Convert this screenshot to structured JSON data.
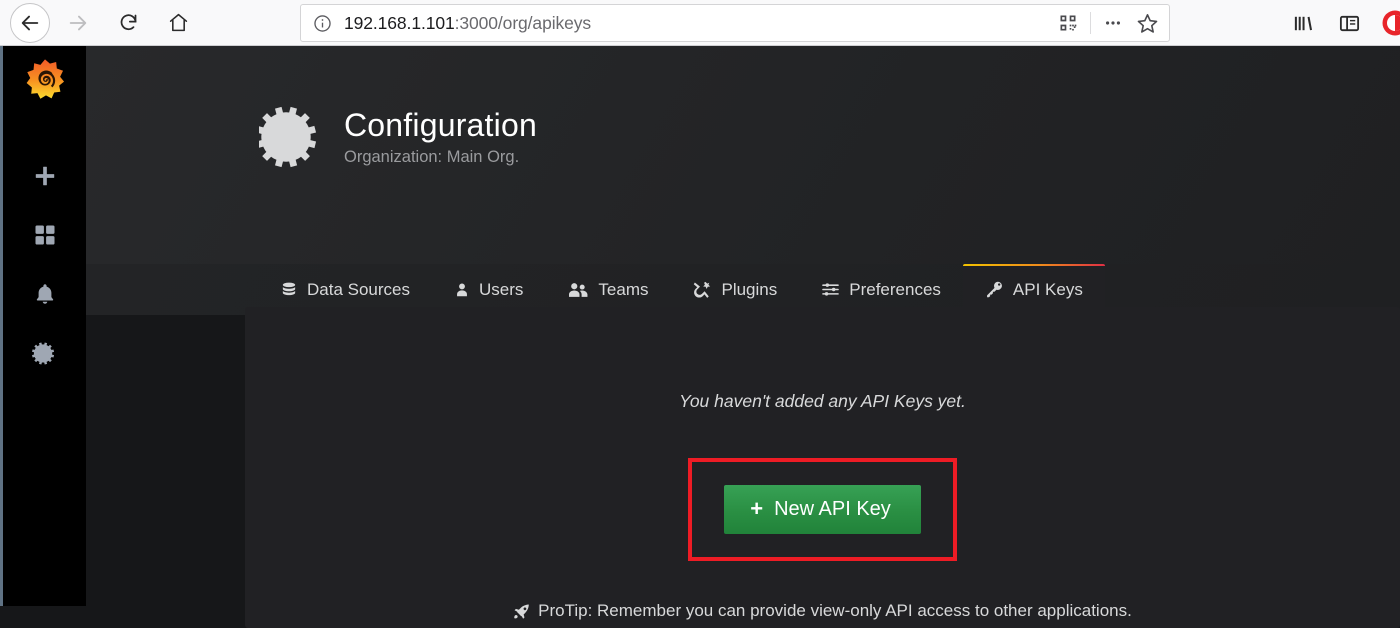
{
  "browser": {
    "back_label": "back-arrow",
    "forward_label": "forward-arrow",
    "reload_label": "reload",
    "home_label": "home",
    "url_host": "192.168.1.101",
    "url_path": ":3000/org/apikeys",
    "url_full": "192.168.1.101:3000/org/apikeys",
    "icons": {
      "info": "info-icon",
      "qr": "qr-code-icon",
      "more": "page-actions-icon",
      "bookmark": "star-icon",
      "library": "library-icon",
      "sidebar": "sidebar-toggle-icon",
      "extension": "extension-icon"
    }
  },
  "sidebar": {
    "brand": "grafana-logo",
    "items": [
      {
        "name": "create",
        "icon": "plus-icon"
      },
      {
        "name": "dashboards",
        "icon": "dashboards-icon"
      },
      {
        "name": "alerting",
        "icon": "bell-icon"
      },
      {
        "name": "configuration",
        "icon": "gear-icon"
      }
    ]
  },
  "header": {
    "icon": "gear-icon",
    "title": "Configuration",
    "subtitle": "Organization: Main Org."
  },
  "tabs": [
    {
      "label": "Data Sources",
      "icon": "database-icon",
      "active": false
    },
    {
      "label": "Users",
      "icon": "user-icon",
      "active": false
    },
    {
      "label": "Teams",
      "icon": "users-icon",
      "active": false
    },
    {
      "label": "Plugins",
      "icon": "plug-icon",
      "active": false
    },
    {
      "label": "Preferences",
      "icon": "sliders-icon",
      "active": false
    },
    {
      "label": "API Keys",
      "icon": "key-icon",
      "active": true
    }
  ],
  "main": {
    "empty_message": "You haven't added any API Keys yet.",
    "new_key_button": "New API Key",
    "new_key_plus": "+",
    "protip": "ProTip: Remember you can provide view-only API access to other applications."
  },
  "colors": {
    "accent_green": "#2a8f43",
    "highlight_red": "#ee1c25",
    "tab_gradient_start": "#f2c200",
    "tab_gradient_end": "#e02f44",
    "panel_bg": "#212124",
    "page_bg": "#161719",
    "sidebar_bg": "#000000"
  }
}
